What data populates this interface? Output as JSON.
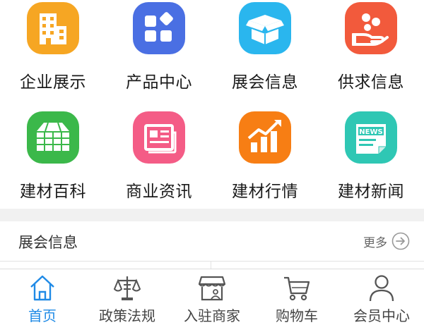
{
  "grid": {
    "items": [
      {
        "label": "企业展示",
        "icon": "building-icon",
        "color": "#F6A623"
      },
      {
        "label": "产品中心",
        "icon": "product-squares-icon",
        "color": "#4A6FE3"
      },
      {
        "label": "展会信息",
        "icon": "open-box-icon",
        "color": "#2AB6EE"
      },
      {
        "label": "供求信息",
        "icon": "hand-coins-icon",
        "color": "#F25A3C"
      },
      {
        "label": "建材百科",
        "icon": "encyclopedia-stack-icon",
        "color": "#3BB84A"
      },
      {
        "label": "商业资讯",
        "icon": "newspaper-icon",
        "color": "#F45C86"
      },
      {
        "label": "建材行情",
        "icon": "rising-chart-icon",
        "color": "#F77E14"
      },
      {
        "label": "建材新闻",
        "icon": "news-card-icon",
        "color": "#2FC7B4"
      }
    ]
  },
  "section": {
    "title": "展会信息",
    "more_label": "更多"
  },
  "tabbar": {
    "active_color": "#1f8ae6",
    "tabs": [
      {
        "label": "首页",
        "icon": "home-icon",
        "active": true
      },
      {
        "label": "政策法规",
        "icon": "scales-icon",
        "active": false
      },
      {
        "label": "入驻商家",
        "icon": "storefront-icon",
        "active": false
      },
      {
        "label": "购物车",
        "icon": "cart-icon",
        "active": false
      },
      {
        "label": "会员中心",
        "icon": "user-icon",
        "active": false
      }
    ]
  }
}
